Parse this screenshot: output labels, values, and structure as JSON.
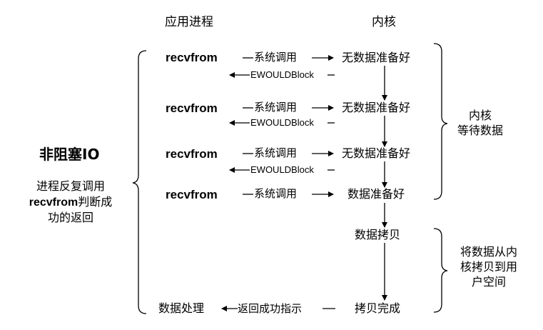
{
  "headers": {
    "app": "应用进程",
    "kernel": "内核"
  },
  "left_title": "非阻塞IO",
  "left_desc": {
    "line1": "进程反复调用",
    "line2_bold": "recvfrom",
    "line2_rest": "判断成",
    "line3": "功的返回"
  },
  "rows": [
    {
      "app": "recvfrom",
      "call": "系统调用",
      "kernel": "无数据准备好",
      "reply": "EWOULDBlock"
    },
    {
      "app": "recvfrom",
      "call": "系统调用",
      "kernel": "无数据准备好",
      "reply": "EWOULDBlock"
    },
    {
      "app": "recvfrom",
      "call": "系统调用",
      "kernel": "无数据准备好",
      "reply": "EWOULDBlock"
    },
    {
      "app": "recvfrom",
      "call": "系统调用",
      "kernel": "数据准备好"
    }
  ],
  "copy_step": "数据拷贝",
  "copy_done": "拷贝完成",
  "final": {
    "app": "数据处理",
    "reply": "返回成功指示"
  },
  "notes": {
    "wait": {
      "line1": "内核",
      "line2": "等待数据"
    },
    "copy": {
      "line1": "将数据从内",
      "line2": "核拷贝到用",
      "line3": "户空间"
    }
  }
}
